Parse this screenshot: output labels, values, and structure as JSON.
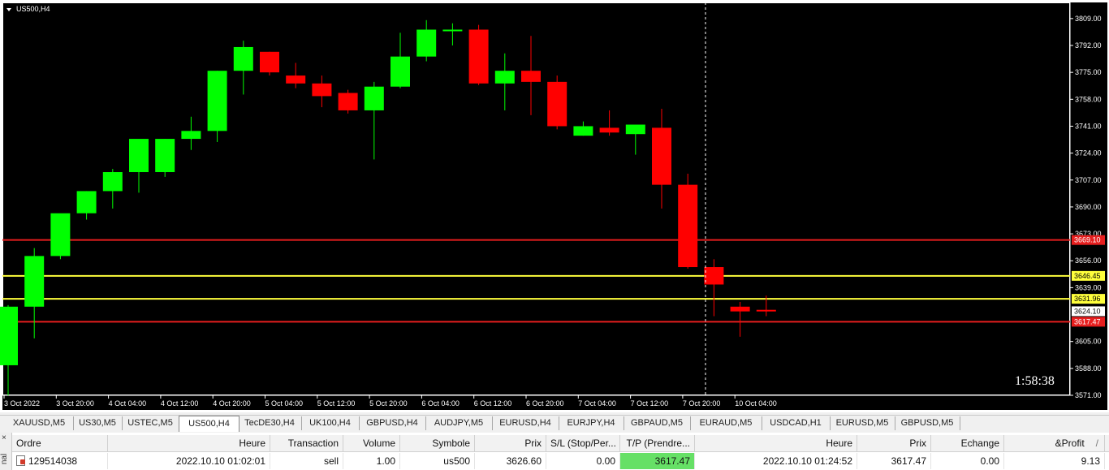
{
  "chart": {
    "symbol_label": "US500,H4",
    "countdown": "1:58:38",
    "colors": {
      "background": "#000000",
      "bull": "#00ff00",
      "bear": "#ff0000",
      "stop_line": "#e61e1e",
      "tp_line": "#ffff3c",
      "grid_text": "#ffffff"
    },
    "price_axis_ticks": [
      "3809.00",
      "3792.00",
      "3775.00",
      "3758.00",
      "3741.00",
      "3724.00",
      "3707.00",
      "3690.00",
      "3673.00",
      "3656.00",
      "3639.00",
      "3605.00",
      "3588.00",
      "3571.00"
    ],
    "price_labels": [
      {
        "text": "3669.10",
        "type": "stop"
      },
      {
        "text": "3646.45",
        "type": "tp"
      },
      {
        "text": "3631.96",
        "type": "tp"
      },
      {
        "text": "3624.10",
        "type": "current"
      },
      {
        "text": "3617.47",
        "type": "stop"
      }
    ],
    "time_ticks": [
      "3 Oct 2022",
      "3 Oct 20:00",
      "4 Oct 04:00",
      "4 Oct 12:00",
      "4 Oct 20:00",
      "5 Oct 04:00",
      "5 Oct 12:00",
      "5 Oct 20:00",
      "6 Oct 04:00",
      "6 Oct 12:00",
      "6 Oct 20:00",
      "7 Oct 04:00",
      "7 Oct 12:00",
      "7 Oct 20:00",
      "10 Oct 04:00"
    ]
  },
  "chart_data": {
    "type": "candlestick",
    "price_range": [
      3571,
      3812
    ],
    "candles": [
      {
        "o": 3590,
        "h": 3628,
        "l": 3571,
        "c": 3627
      },
      {
        "o": 3627,
        "h": 3664,
        "l": 3607,
        "c": 3659
      },
      {
        "o": 3659,
        "h": 3684,
        "l": 3657,
        "c": 3686
      },
      {
        "o": 3686,
        "h": 3700,
        "l": 3682,
        "c": 3700
      },
      {
        "o": 3700,
        "h": 3714,
        "l": 3689,
        "c": 3712
      },
      {
        "o": 3712,
        "h": 3732,
        "l": 3699,
        "c": 3733
      },
      {
        "o": 3712,
        "h": 3733,
        "l": 3709,
        "c": 3733
      },
      {
        "o": 3733,
        "h": 3747,
        "l": 3726,
        "c": 3738
      },
      {
        "o": 3738,
        "h": 3776,
        "l": 3731,
        "c": 3776
      },
      {
        "o": 3776,
        "h": 3795,
        "l": 3761,
        "c": 3791
      },
      {
        "o": 3788,
        "h": 3788,
        "l": 3773,
        "c": 3775
      },
      {
        "o": 3773,
        "h": 3781,
        "l": 3765,
        "c": 3768
      },
      {
        "o": 3768,
        "h": 3773,
        "l": 3753,
        "c": 3760
      },
      {
        "o": 3762,
        "h": 3764,
        "l": 3749,
        "c": 3751
      },
      {
        "o": 3751,
        "h": 3769,
        "l": 3720,
        "c": 3766
      },
      {
        "o": 3766,
        "h": 3800,
        "l": 3765,
        "c": 3785
      },
      {
        "o": 3785,
        "h": 3808,
        "l": 3782,
        "c": 3802
      },
      {
        "o": 3802,
        "h": 3806,
        "l": 3792,
        "c": 3802
      },
      {
        "o": 3802,
        "h": 3805,
        "l": 3767,
        "c": 3768
      },
      {
        "o": 3768,
        "h": 3787,
        "l": 3751,
        "c": 3776
      },
      {
        "o": 3776,
        "h": 3798,
        "l": 3748,
        "c": 3769
      },
      {
        "o": 3769,
        "h": 3773,
        "l": 3739,
        "c": 3741
      },
      {
        "o": 3735,
        "h": 3744,
        "l": 3735,
        "c": 3741
      },
      {
        "o": 3740,
        "h": 3751,
        "l": 3735,
        "c": 3737
      },
      {
        "o": 3736,
        "h": 3741,
        "l": 3723,
        "c": 3742
      },
      {
        "o": 3740,
        "h": 3752,
        "l": 3689,
        "c": 3704
      },
      {
        "o": 3704,
        "h": 3711,
        "l": 3651,
        "c": 3652
      },
      {
        "o": 3652,
        "h": 3657,
        "l": 3621,
        "c": 3641
      },
      {
        "o": 3627,
        "h": 3630,
        "l": 3608,
        "c": 3624
      },
      {
        "o": 3625,
        "h": 3634,
        "l": 3621,
        "c": 3624
      }
    ],
    "horizontal_lines": [
      {
        "price": 3669.1,
        "type": "stop"
      },
      {
        "price": 3646.45,
        "type": "tp"
      },
      {
        "price": 3631.96,
        "type": "tp"
      },
      {
        "price": 3617.47,
        "type": "stop"
      }
    ]
  },
  "tabs": [
    {
      "label": "XAUUSD,M5",
      "active": false
    },
    {
      "label": "US30,M5",
      "active": false
    },
    {
      "label": "USTEC,M5",
      "active": false
    },
    {
      "label": "US500,H4",
      "active": true
    },
    {
      "label": "TecDE30,H4",
      "active": false
    },
    {
      "label": "UK100,H4",
      "active": false
    },
    {
      "label": "GBPUSD,H4",
      "active": false
    },
    {
      "label": "AUDJPY,M5",
      "active": false
    },
    {
      "label": "EURUSD,H4",
      "active": false
    },
    {
      "label": "EURJPY,H4",
      "active": false
    },
    {
      "label": "GBPAUD,M5",
      "active": false
    },
    {
      "label": "EURAUD,M5",
      "active": false
    },
    {
      "label": "USDCAD,H1",
      "active": false
    },
    {
      "label": "EURUSD,M5",
      "active": false
    },
    {
      "label": "GBPUSD,M5",
      "active": false
    }
  ],
  "terminal": {
    "side_label": "nal",
    "close_label": "×",
    "columns": [
      "Ordre",
      "Heure",
      "Transaction",
      "Volume",
      "Symbole",
      "Prix",
      "S/L (Stop/Per...",
      "T/P (Prendre...",
      "Heure",
      "Prix",
      "Echange",
      "&Profit"
    ],
    "sort_glyph": "/",
    "rows": [
      {
        "cells": [
          "129514038",
          "2022.10.10 01:02:01",
          "sell",
          "1.00",
          "us500",
          "3626.60",
          "0.00",
          "3617.47",
          "2022.10.10 01:24:52",
          "3617.47",
          "0.00",
          "9.13"
        ]
      }
    ]
  }
}
